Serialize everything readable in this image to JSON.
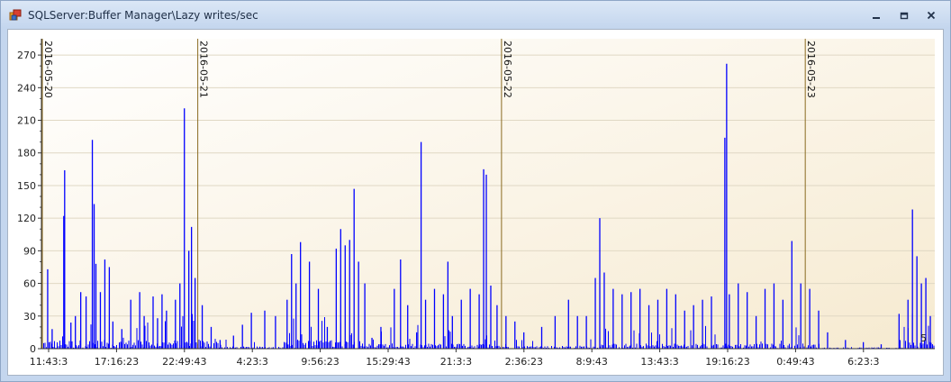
{
  "window": {
    "title": "SQLServer:Buffer Manager\\Lazy writes/sec",
    "minimize_icon": "minimize-icon",
    "restore_icon": "restore-icon",
    "close_icon": "close-icon"
  },
  "chart_data": {
    "type": "bar",
    "ylim": [
      0,
      285
    ],
    "yticks": [
      0,
      30,
      60,
      90,
      120,
      150,
      180,
      210,
      240,
      270
    ],
    "xticks": [
      "11:43:3",
      "17:16:23",
      "22:49:43",
      "4:23:3",
      "9:56:23",
      "15:29:43",
      "21:3:3",
      "2:36:23",
      "8:9:43",
      "13:43:3",
      "19:16:23",
      "0:49:43",
      "6:23:3"
    ],
    "day_markers": [
      "2016-05-20",
      "2016-05-21",
      "2016-05-22",
      "2016-05-23"
    ],
    "day_marker_positions": [
      0.0,
      0.174,
      0.514,
      0.854
    ],
    "grid": true,
    "bar_color": "#0000ff",
    "marker_color": "#8a6a20",
    "peaks": [
      [
        0.007,
        73
      ],
      [
        0.012,
        18
      ],
      [
        0.025,
        122
      ],
      [
        0.026,
        164
      ],
      [
        0.033,
        24
      ],
      [
        0.038,
        30
      ],
      [
        0.044,
        52
      ],
      [
        0.05,
        48
      ],
      [
        0.057,
        192
      ],
      [
        0.059,
        133
      ],
      [
        0.061,
        78
      ],
      [
        0.066,
        52
      ],
      [
        0.071,
        82
      ],
      [
        0.076,
        75
      ],
      [
        0.08,
        25
      ],
      [
        0.09,
        18
      ],
      [
        0.1,
        45
      ],
      [
        0.11,
        52
      ],
      [
        0.115,
        30
      ],
      [
        0.125,
        48
      ],
      [
        0.13,
        28
      ],
      [
        0.135,
        50
      ],
      [
        0.14,
        35
      ],
      [
        0.15,
        45
      ],
      [
        0.155,
        60
      ],
      [
        0.16,
        221
      ],
      [
        0.165,
        90
      ],
      [
        0.168,
        112
      ],
      [
        0.172,
        65
      ],
      [
        0.18,
        40
      ],
      [
        0.19,
        20
      ],
      [
        0.2,
        8
      ],
      [
        0.215,
        12
      ],
      [
        0.225,
        22
      ],
      [
        0.235,
        33
      ],
      [
        0.25,
        35
      ],
      [
        0.262,
        30
      ],
      [
        0.275,
        45
      ],
      [
        0.28,
        87
      ],
      [
        0.285,
        60
      ],
      [
        0.29,
        98
      ],
      [
        0.3,
        80
      ],
      [
        0.31,
        55
      ],
      [
        0.32,
        20
      ],
      [
        0.33,
        92
      ],
      [
        0.335,
        110
      ],
      [
        0.34,
        95
      ],
      [
        0.345,
        100
      ],
      [
        0.35,
        147
      ],
      [
        0.355,
        80
      ],
      [
        0.362,
        60
      ],
      [
        0.37,
        10
      ],
      [
        0.38,
        20
      ],
      [
        0.395,
        55
      ],
      [
        0.402,
        82
      ],
      [
        0.41,
        40
      ],
      [
        0.42,
        15
      ],
      [
        0.425,
        190
      ],
      [
        0.43,
        45
      ],
      [
        0.44,
        55
      ],
      [
        0.45,
        50
      ],
      [
        0.455,
        80
      ],
      [
        0.46,
        30
      ],
      [
        0.47,
        45
      ],
      [
        0.48,
        55
      ],
      [
        0.49,
        50
      ],
      [
        0.495,
        165
      ],
      [
        0.498,
        160
      ],
      [
        0.503,
        58
      ],
      [
        0.51,
        40
      ],
      [
        0.52,
        30
      ],
      [
        0.53,
        25
      ],
      [
        0.54,
        15
      ],
      [
        0.56,
        20
      ],
      [
        0.575,
        30
      ],
      [
        0.59,
        45
      ],
      [
        0.6,
        30
      ],
      [
        0.61,
        30
      ],
      [
        0.62,
        65
      ],
      [
        0.625,
        120
      ],
      [
        0.63,
        70
      ],
      [
        0.64,
        55
      ],
      [
        0.65,
        50
      ],
      [
        0.66,
        52
      ],
      [
        0.67,
        55
      ],
      [
        0.68,
        40
      ],
      [
        0.69,
        45
      ],
      [
        0.7,
        55
      ],
      [
        0.71,
        50
      ],
      [
        0.72,
        35
      ],
      [
        0.73,
        40
      ],
      [
        0.74,
        45
      ],
      [
        0.75,
        48
      ],
      [
        0.765,
        194
      ],
      [
        0.767,
        262
      ],
      [
        0.77,
        50
      ],
      [
        0.78,
        60
      ],
      [
        0.79,
        52
      ],
      [
        0.8,
        30
      ],
      [
        0.81,
        55
      ],
      [
        0.82,
        60
      ],
      [
        0.83,
        45
      ],
      [
        0.84,
        99
      ],
      [
        0.85,
        60
      ],
      [
        0.86,
        55
      ],
      [
        0.87,
        35
      ],
      [
        0.88,
        15
      ],
      [
        0.9,
        8
      ],
      [
        0.92,
        6
      ],
      [
        0.94,
        4
      ],
      [
        0.96,
        32
      ],
      [
        0.97,
        45
      ],
      [
        0.975,
        128
      ],
      [
        0.98,
        85
      ],
      [
        0.985,
        60
      ],
      [
        0.99,
        65
      ],
      [
        0.995,
        30
      ]
    ]
  },
  "legend_fragment": "5"
}
